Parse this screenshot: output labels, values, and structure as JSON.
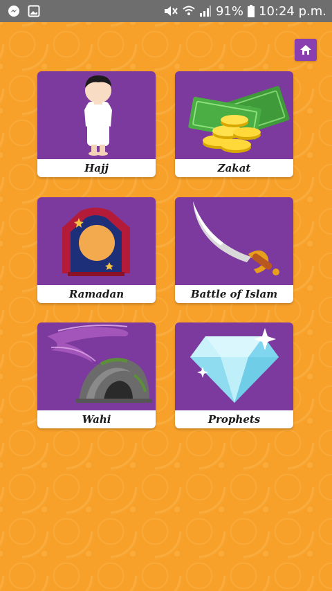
{
  "status_bar": {
    "battery": "91%",
    "time": "10:24 p.m.",
    "icons": [
      "messenger-icon",
      "gallery-icon",
      "mute-icon",
      "wifi-icon",
      "signal-icon",
      "battery-icon"
    ]
  },
  "header": {
    "home_icon": "home-icon"
  },
  "cards": [
    {
      "label": "Hajj",
      "icon": "pilgrim-boy-icon"
    },
    {
      "label": "Zakat",
      "icon": "money-coins-icon"
    },
    {
      "label": "Ramadan",
      "icon": "moon-window-icon"
    },
    {
      "label": "Battle of Islam",
      "icon": "sword-icon"
    },
    {
      "label": "Wahi",
      "icon": "cave-icon"
    },
    {
      "label": "Prophets",
      "icon": "diamond-icon"
    }
  ],
  "colors": {
    "background": "#f7a12a",
    "card": "#7d3a9e",
    "home_button": "#8a3fb1",
    "status_bar": "#6e6e6e"
  }
}
